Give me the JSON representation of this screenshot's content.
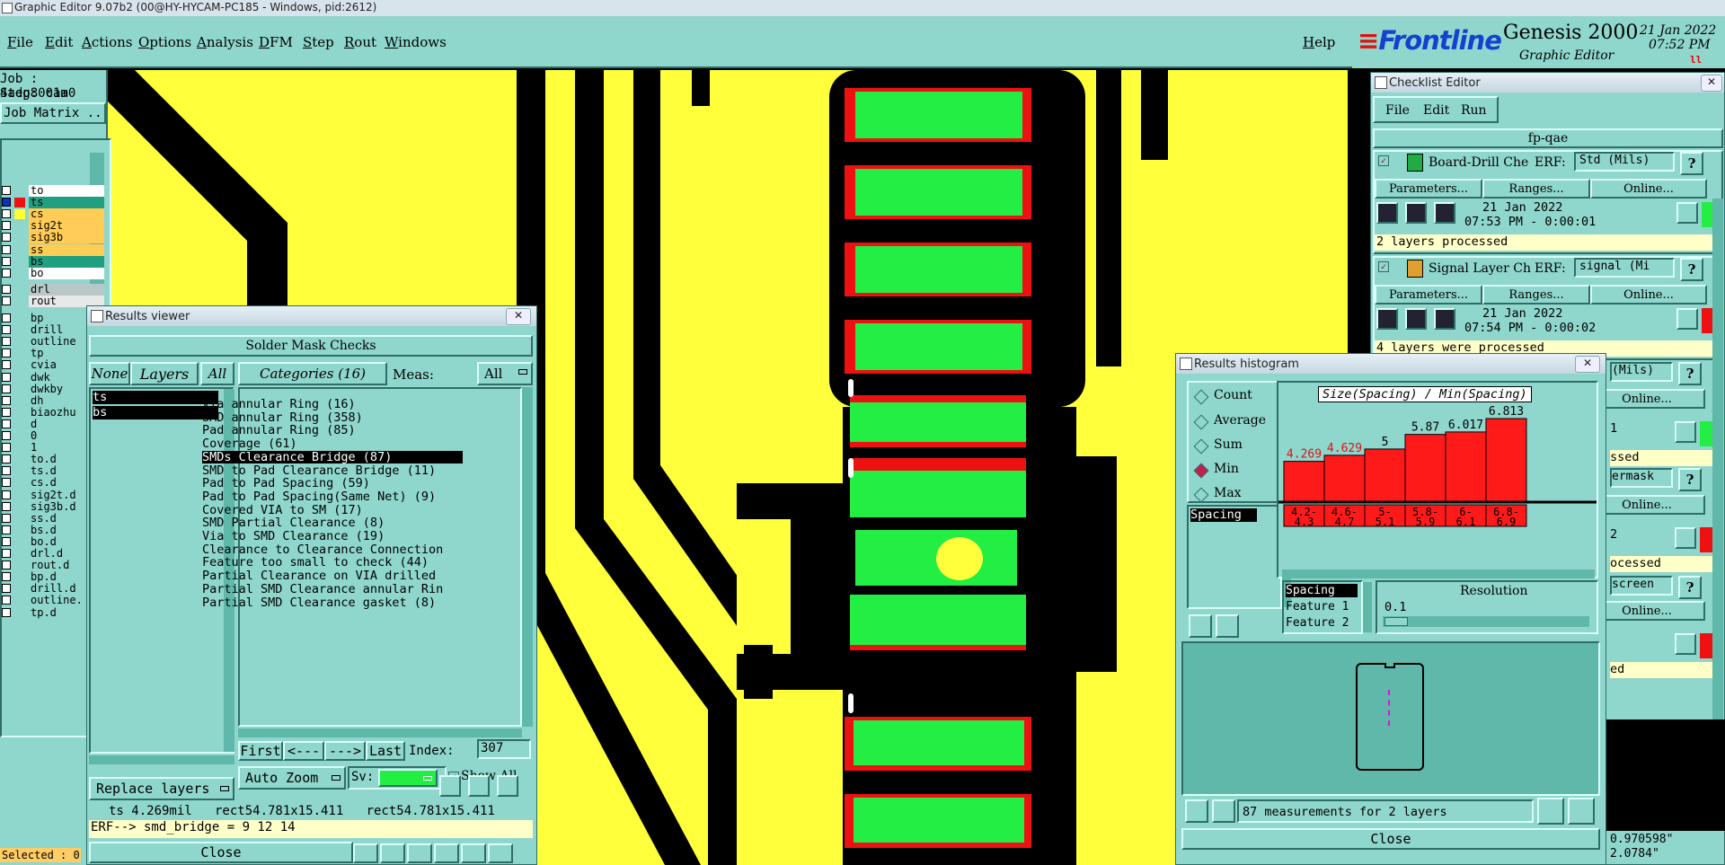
{
  "window_title": "Graphic Editor 9.07b2 (00@HY-HYCAM-PC185 - Windows, pid:2612)",
  "menu": [
    "File",
    "Edit",
    "Actions",
    "Options",
    "Analysis",
    "DFM",
    "Step",
    "Rout",
    "Windows"
  ],
  "help": "Help",
  "brand": {
    "name": "Frontline",
    "product": "Genesis 2000",
    "subtitle": "Graphic Editor",
    "date": "21 Jan 2022",
    "time": "07:52 PM"
  },
  "job": {
    "job_label": "Job : 4adg8001a0",
    "step_label": "Step: cam",
    "matrix_button": "Job Matrix ..."
  },
  "layers": [
    "to",
    "ts",
    "cs",
    "sig2t",
    "sig3b",
    "ss",
    "bs",
    "bo",
    "drl",
    "rout",
    "bp",
    "drill",
    "outline",
    "tp",
    "cvia",
    "dwk",
    "dwkby",
    "dh",
    "biaozhu",
    "d",
    "0",
    "1",
    "to.d",
    "ts.d",
    "cs.d",
    "sig2t.d",
    "sig3b.d",
    "ss.d",
    "bs.d",
    "bo.d",
    "drl.d",
    "rout.d",
    "bp.d",
    "drill.d",
    "outline.",
    "tp.d"
  ],
  "selected_label": "Selected : 0",
  "results_viewer": {
    "title": "Results viewer",
    "header": "Solder Mask Checks",
    "btn_none": "None",
    "btn_layers": "Layers",
    "btn_all": "All",
    "layer_list": [
      "ts",
      "bs"
    ],
    "categories_btn": "Categories (16)",
    "meas_label": "Meas:",
    "meas_value": "All",
    "categories": [
      "Via annular Ring (16)",
      "SMD annular Ring (358)",
      "Pad annular Ring (85)",
      "Coverage (61)",
      "SMDs Clearance Bridge (87)",
      "SMD to Pad Clearance Bridge (11)",
      "Pad to Pad Spacing (59)",
      "Pad to Pad Spacing(Same Net) (9)",
      "Covered VIA to SM (17)",
      "SMD Partial Clearance (8)",
      "Via to SMD Clearance (19)",
      "Clearance to Clearance Connection",
      "Feature too small to check (44)",
      "Partial Clearance on VIA drilled",
      "Partial SMD Clearance annular Rin",
      "Partial SMD Clearance gasket (8)"
    ],
    "nav": {
      "first": "First",
      "prev": "<---",
      "next": "--->",
      "last": "Last",
      "index_label": "Index:",
      "index_value": "307"
    },
    "auto_zoom": "Auto Zoom",
    "sv_label": "Sv:",
    "show_all": "Show All",
    "replace_layers": "Replace layers",
    "status": "ts 4.269mil   rect54.781x15.411   rect54.781x15.411",
    "erf": "ERF--> smd_bridge = 9 12 14",
    "close": "Close"
  },
  "histogram": {
    "title": "Results histogram",
    "modes": [
      "Count",
      "Average",
      "Sum",
      "Min",
      "Max"
    ],
    "selected_mode": "Min",
    "list": [
      "Spacing"
    ],
    "chart_title": "Size(Spacing) / Min(Spacing)",
    "resolution_label": "Resolution",
    "resolution_value": "0.1",
    "spacing_items": [
      "Spacing",
      "Feature 1",
      "Feature 2"
    ],
    "summary": "87 measurements for 2 layers",
    "close": "Close"
  },
  "chart_data": {
    "type": "bar",
    "title": "Size(Spacing) / Min(Spacing)",
    "categories": [
      "4.2-4.3",
      "4.6-4.7",
      "5-5.1",
      "5.8-5.9",
      "6-6.1",
      "6.8-6.9"
    ],
    "values": [
      4.269,
      4.629,
      5,
      5.87,
      6.017,
      6.813
    ],
    "value_labels": [
      "4.269",
      "4.629",
      "5",
      "5.87",
      "6.017",
      "6.813"
    ]
  },
  "checklist": {
    "title": "Checklist Editor",
    "menu": [
      "File",
      "Edit",
      "Run"
    ],
    "name": "fp-qae",
    "checks": [
      {
        "name": "Board-Drill Che",
        "erf_label": "ERF:",
        "erf_value": "Std (Mils)",
        "date": "21 Jan 2022",
        "time": "07:53 PM - 0:00:01",
        "status": "2 layers processed"
      },
      {
        "name": "Signal Layer Ch",
        "erf_label": "ERF:",
        "erf_value": "signal (Mi",
        "date": "21 Jan 2022",
        "time": "07:54 PM - 0:00:02",
        "status": "4 layers were processed"
      }
    ],
    "parameters": "Parameters...",
    "ranges": "Ranges...",
    "online": "Online...",
    "question": "?",
    "partial_erf": [
      "(Mils)",
      "ermask",
      "screen"
    ],
    "partial_status": [
      "ssed",
      "ocessed",
      "ed"
    ],
    "partial_nums": [
      "1",
      "2"
    ]
  },
  "coords": {
    "x": "0.970598\"",
    "y": "2.0784\""
  }
}
